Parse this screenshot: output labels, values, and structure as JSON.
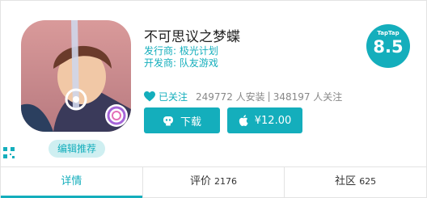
{
  "app": {
    "title": "不可思议之梦蝶",
    "publisher_label": "发行商:",
    "publisher": "极光计划",
    "developer_label": "开发商:",
    "developer": "队友游戏",
    "badge": "编辑推荐",
    "icon": "game-app-icon"
  },
  "rating": {
    "brand": "TapTap",
    "score": "8.5"
  },
  "stats": {
    "followed_label": "已关注",
    "installs": "249772 人安装",
    "separator": "|",
    "followers": "348197 人关注"
  },
  "buttons": {
    "download": "下载",
    "buy": "¥12.00"
  },
  "tabs": [
    {
      "label": "详情",
      "count": ""
    },
    {
      "label": "评价",
      "count": "2176"
    },
    {
      "label": "社区",
      "count": "625"
    }
  ],
  "colors": {
    "accent": "#14aebc",
    "badge_bg": "#cfeff1",
    "text": "#222222",
    "muted": "#888888"
  }
}
